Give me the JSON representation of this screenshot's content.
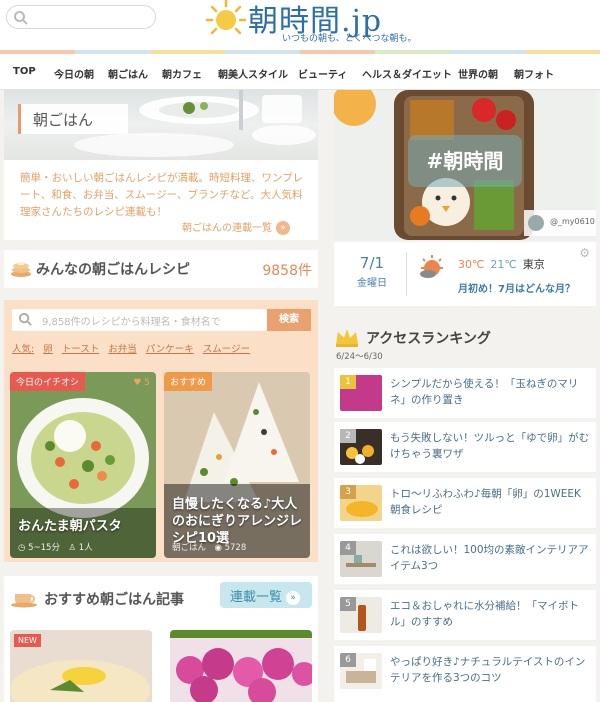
{
  "header": {
    "logo_text": "朝時間.jp",
    "logo_sub": "いつもの朝も、とくべつな朝も。",
    "stripe_colors": [
      "#f4c9b0",
      "#cfe3f3",
      "#f7df9e",
      "#cfe3f3",
      "#f4c9b0",
      "#d7ebc9",
      "#cfe3f3",
      "#f7df9e"
    ]
  },
  "nav": [
    "TOP",
    "今日の朝",
    "朝ごはん",
    "朝カフェ",
    "朝美人スタイル",
    "ビューティ",
    "ヘルス＆ダイエット",
    "世界の朝",
    "朝フォト"
  ],
  "feature": {
    "label": "朝ごはん",
    "desc": "簡単・おいしい朝ごはんレシピが満載。時短料理、ワンプレート、和食、お弁当、スムージー、ブランチなど。大人気料理家さんたちのレシピ連載も！",
    "link": "朝ごはんの連載一覧",
    "arrow": "»"
  },
  "recipes_section": {
    "title": "みんなの朝ごはんレシピ",
    "count": "9858件",
    "search_placeholder": "9,858件のレシピから料理名・食材名で",
    "search_button": "検索",
    "tags_label": "人気:",
    "tags": [
      "卵",
      "トースト",
      "お弁当",
      "パンケーキ",
      "スムージー"
    ],
    "cards": [
      {
        "badge": "今日のイチオシ",
        "likes": "5",
        "title": "おんたま朝パスタ",
        "meta": "◷ 5~15分　♙ 1人"
      },
      {
        "badge": "おすすめ",
        "title": "自慢したくなる♪大人のおにぎりアレンジレシピ10選",
        "meta": "朝ごはん　◉ 5728"
      }
    ]
  },
  "articles_section": {
    "title": "おすすめ朝ごはん記事",
    "button": "連載一覧",
    "arrow": "»",
    "new_badge": "NEW"
  },
  "hero": {
    "hashtag": "#朝時間",
    "user": "@_my0610"
  },
  "weather": {
    "date": "7/1",
    "weekday": "金曜日",
    "high": "30℃",
    "low": "21℃",
    "city": "東京",
    "message": "月初め！7月はどんな月？"
  },
  "ranking": {
    "title": "アクセスランキング",
    "period": "6/24〜6/30",
    "items": [
      {
        "num": "1",
        "text": "シンプルだから使える！「玉ねぎのマリネ」の作り置き"
      },
      {
        "num": "2",
        "text": "もう失敗しない！ツルっと「ゆで卵」がむけちゃう裏ワザ"
      },
      {
        "num": "3",
        "text": "トロ〜リふわふわ♪毎朝「卵」の1WEEK朝食レシピ"
      },
      {
        "num": "4",
        "text": "これは欲しい！100均の素敵インテリアアイテム3つ"
      },
      {
        "num": "5",
        "text": "エコ＆おしゃれに水分補給！「マイボトル」のすすめ"
      },
      {
        "num": "6",
        "text": "やっぱり好き♪ナチュラルテイストのインテリアを作る3つのコツ"
      }
    ]
  }
}
